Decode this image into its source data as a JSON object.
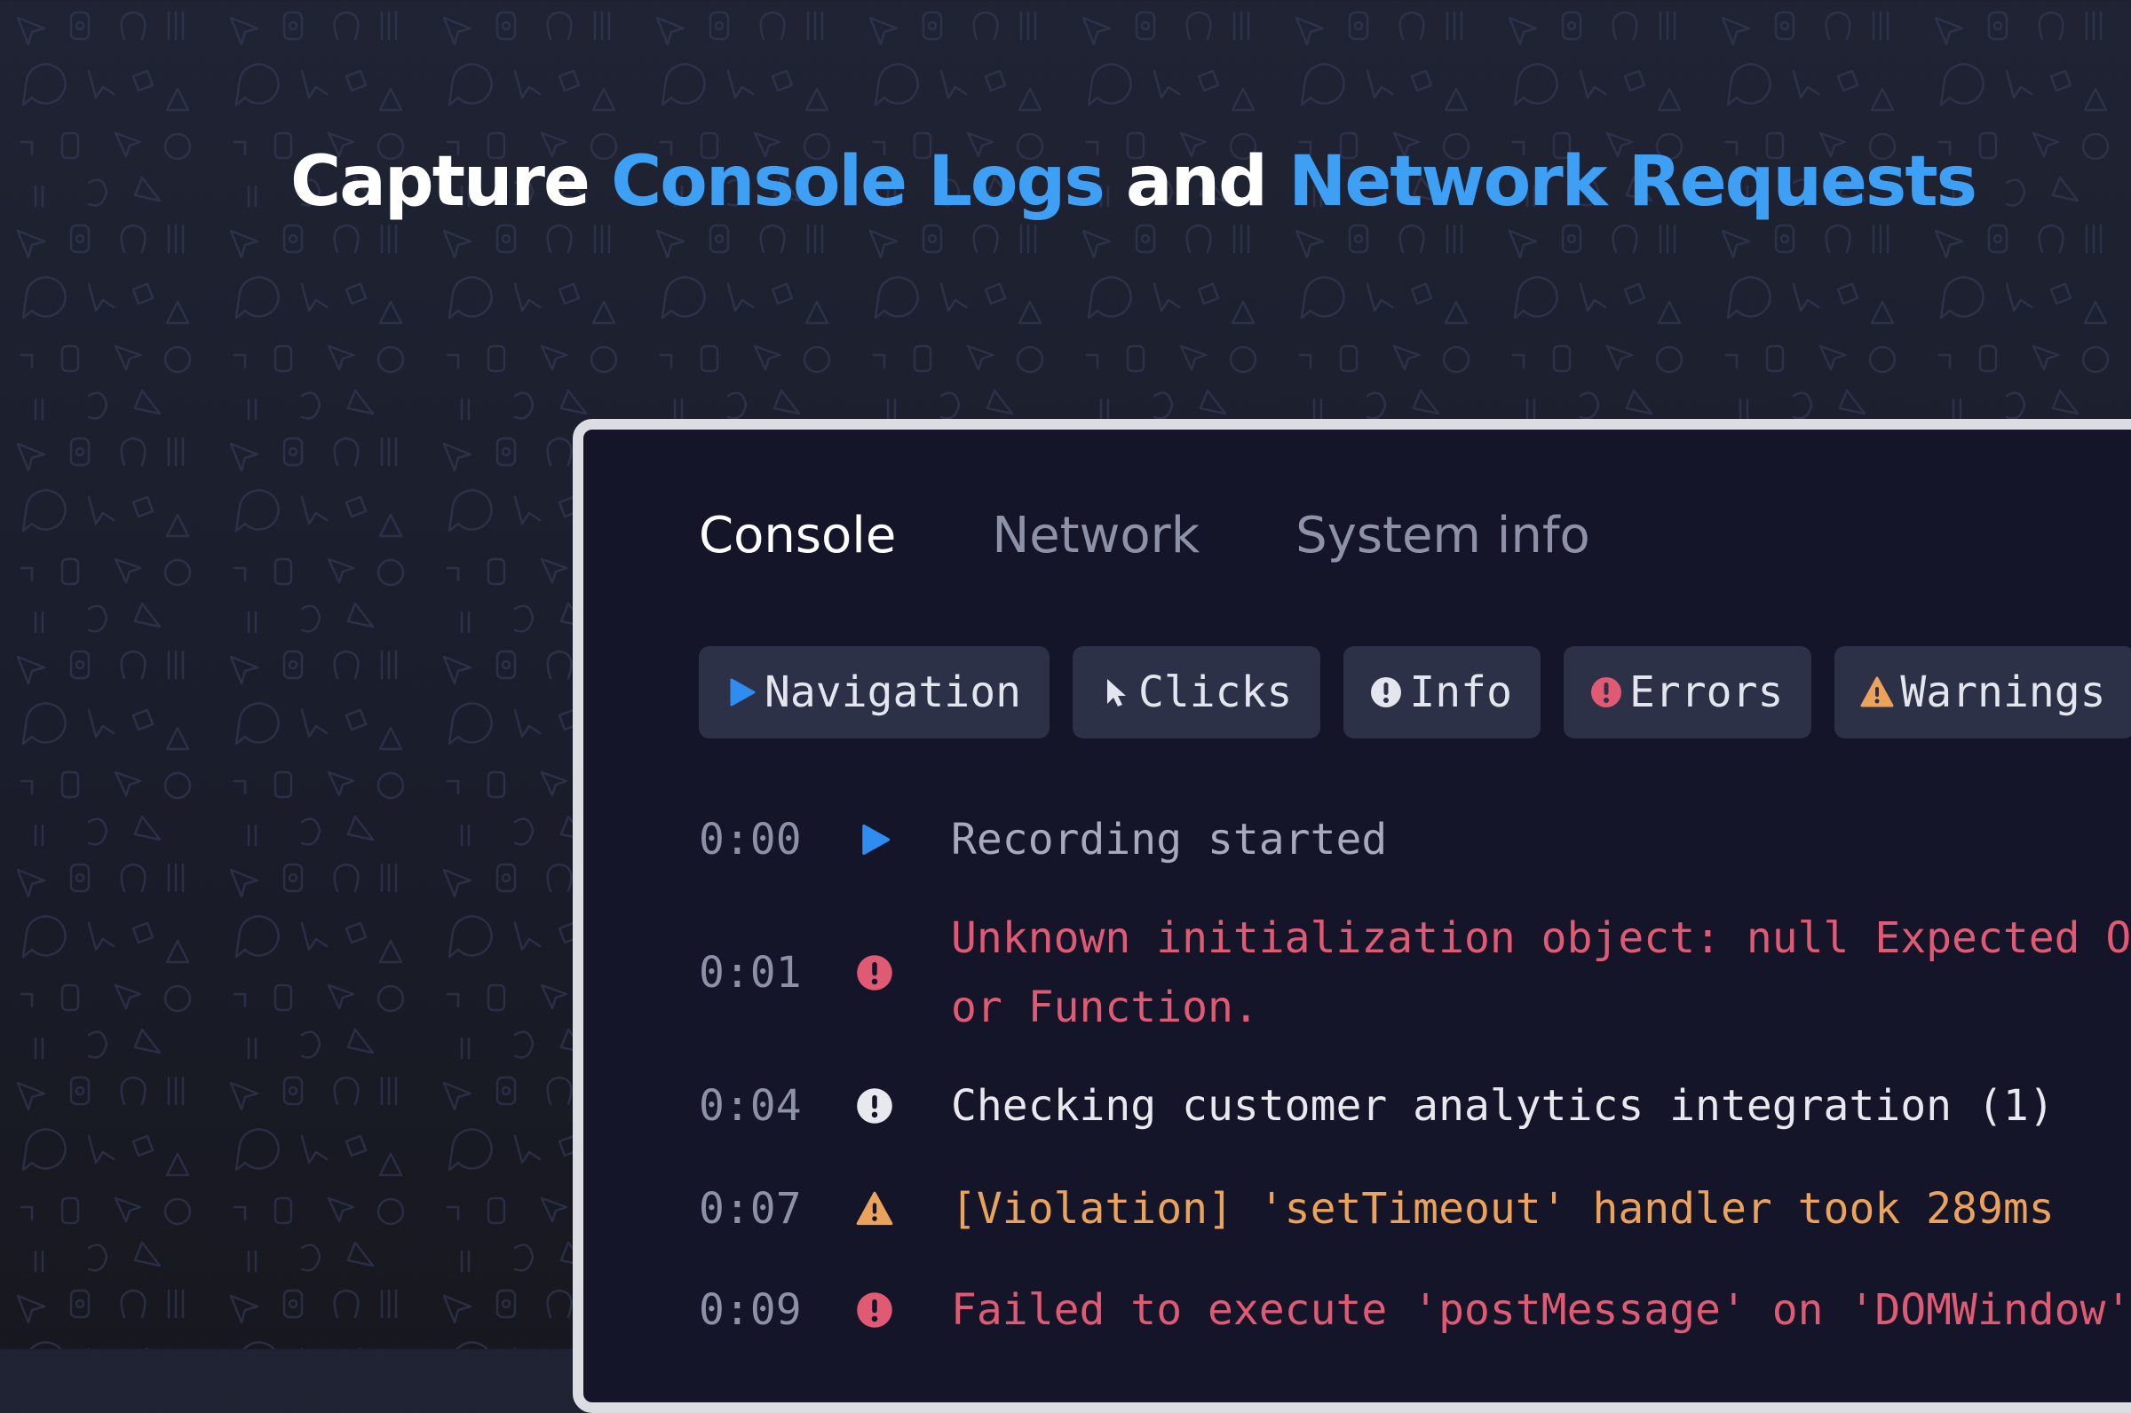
{
  "headline": {
    "part1": "Capture ",
    "part2": "Console Logs",
    "part3": " and ",
    "part4": "Network Requests"
  },
  "colors": {
    "accent": "#3ea0f5",
    "error": "#e05a74",
    "warning": "#eba25a",
    "navigation": "#2f8cf0"
  },
  "tabs": [
    {
      "label": "Console",
      "active": true
    },
    {
      "label": "Network",
      "active": false
    },
    {
      "label": "System info",
      "active": false
    }
  ],
  "filters": [
    {
      "label": "Navigation",
      "icon": "play-icon"
    },
    {
      "label": "Clicks",
      "icon": "cursor-icon"
    },
    {
      "label": "Info",
      "icon": "info-icon"
    },
    {
      "label": "Errors",
      "icon": "error-icon"
    },
    {
      "label": "Warnings",
      "icon": "warning-icon"
    }
  ],
  "logs": [
    {
      "time": "0:00",
      "type": "navigation",
      "icon": "play-icon",
      "lines": [
        "Recording started"
      ]
    },
    {
      "time": "0:01",
      "type": "error",
      "icon": "error-icon",
      "lines": [
        "Unknown initialization object: null Expected Ob",
        "or Function."
      ]
    },
    {
      "time": "0:04",
      "type": "info",
      "icon": "info-icon",
      "lines": [
        "Checking customer analytics integration (1)"
      ]
    },
    {
      "time": "0:07",
      "type": "warning",
      "icon": "warning-icon",
      "lines": [
        "[Violation] 'setTimeout' handler took 289ms"
      ]
    },
    {
      "time": "0:09",
      "type": "error",
      "icon": "error-icon",
      "lines": [
        "Failed to execute 'postMessage' on 'DOMWindow':"
      ]
    }
  ]
}
